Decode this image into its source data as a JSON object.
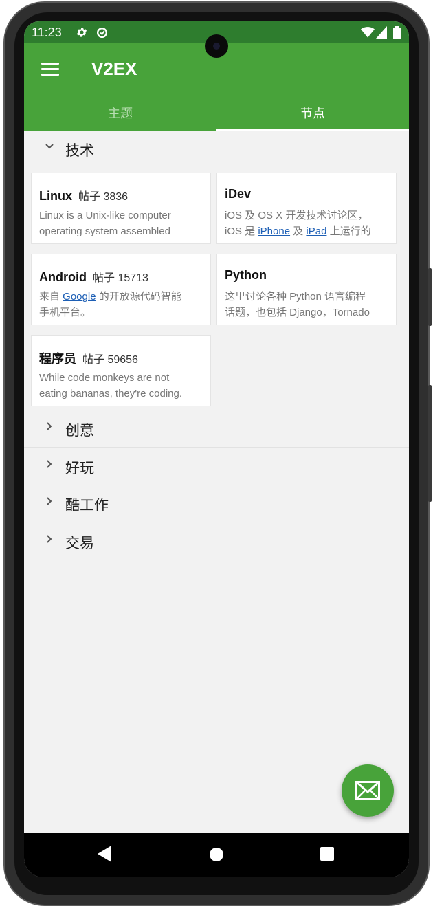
{
  "status": {
    "time": "11:23"
  },
  "app": {
    "title": "V2EX"
  },
  "tabs": [
    {
      "label": "主题"
    },
    {
      "label": "节点"
    }
  ],
  "sections": [
    {
      "label": "技术",
      "expanded": true
    },
    {
      "label": "创意"
    },
    {
      "label": "好玩"
    },
    {
      "label": "酷工作"
    },
    {
      "label": "交易"
    }
  ],
  "nodes": [
    {
      "name": "Linux",
      "count_label": "帖子 3836",
      "desc_l1": "Linux is a Unix-like computer",
      "desc_l2": "operating system assembled"
    },
    {
      "name": "iDev",
      "desc_l1": "iOS 及 OS X 开发技术讨论区，",
      "desc_l2_pre": "iOS 是 ",
      "desc_l2_link1": "iPhone",
      "desc_l2_mid": " 及 ",
      "desc_l2_link2": "iPad",
      "desc_l2_post": " 上运行的"
    },
    {
      "name": "Android",
      "count_label": "帖子 15713",
      "desc_l1_pre": "来自 ",
      "desc_l1_link": "Google",
      "desc_l1_post": " 的开放源代码智能",
      "desc_l2": "手机平台。"
    },
    {
      "name": "Python",
      "desc_l1": "这里讨论各种 Python 语言编程",
      "desc_l2": "话题，也包括 Django，Tornado"
    },
    {
      "name": "程序员",
      "count_label": "帖子 59656",
      "desc_l1": "While code monkeys are not",
      "desc_l2": "eating bananas, they're coding."
    }
  ],
  "colors": {
    "primary": "#48a33a",
    "status_bar": "#2e7d2e",
    "link": "#1d5fb5"
  },
  "icons": {
    "fab": "mail-icon",
    "menu": "menu-icon"
  }
}
